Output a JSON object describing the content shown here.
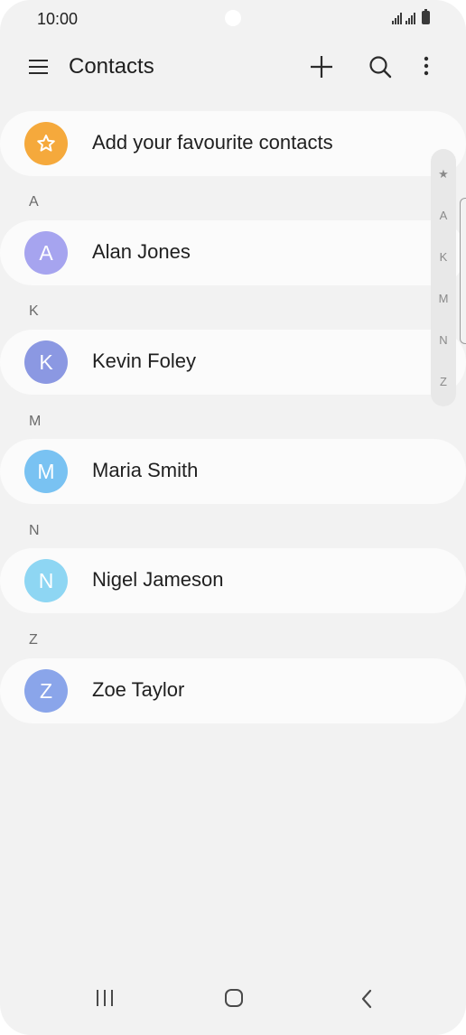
{
  "status_bar": {
    "time": "10:00"
  },
  "app_bar": {
    "title": "Contacts",
    "icons": [
      "menu-icon",
      "add-icon",
      "search-icon",
      "more-options-icon"
    ]
  },
  "favourites": {
    "label": "Add your favourite contacts",
    "icon": "star-icon",
    "color": "#f5a93c"
  },
  "sections": [
    {
      "letter": "A",
      "contact": {
        "initial": "A",
        "name": "Alan Jones",
        "color": "#a6a4ef"
      }
    },
    {
      "letter": "K",
      "contact": {
        "initial": "K",
        "name": "Kevin Foley",
        "color": "#8b98e2"
      }
    },
    {
      "letter": "M",
      "contact": {
        "initial": "M",
        "name": "Maria Smith",
        "color": "#79c2f2"
      }
    },
    {
      "letter": "N",
      "contact": {
        "initial": "N",
        "name": "Nigel Jameson",
        "color": "#8ed6f3"
      }
    },
    {
      "letter": "Z",
      "contact": {
        "initial": "Z",
        "name": "Zoe Taylor",
        "color": "#8aa5ea"
      }
    }
  ],
  "index": [
    "★",
    "A",
    "K",
    "M",
    "N",
    "Z"
  ],
  "nav_bar": {
    "icons": [
      "recents-icon",
      "home-icon",
      "back-icon"
    ]
  }
}
